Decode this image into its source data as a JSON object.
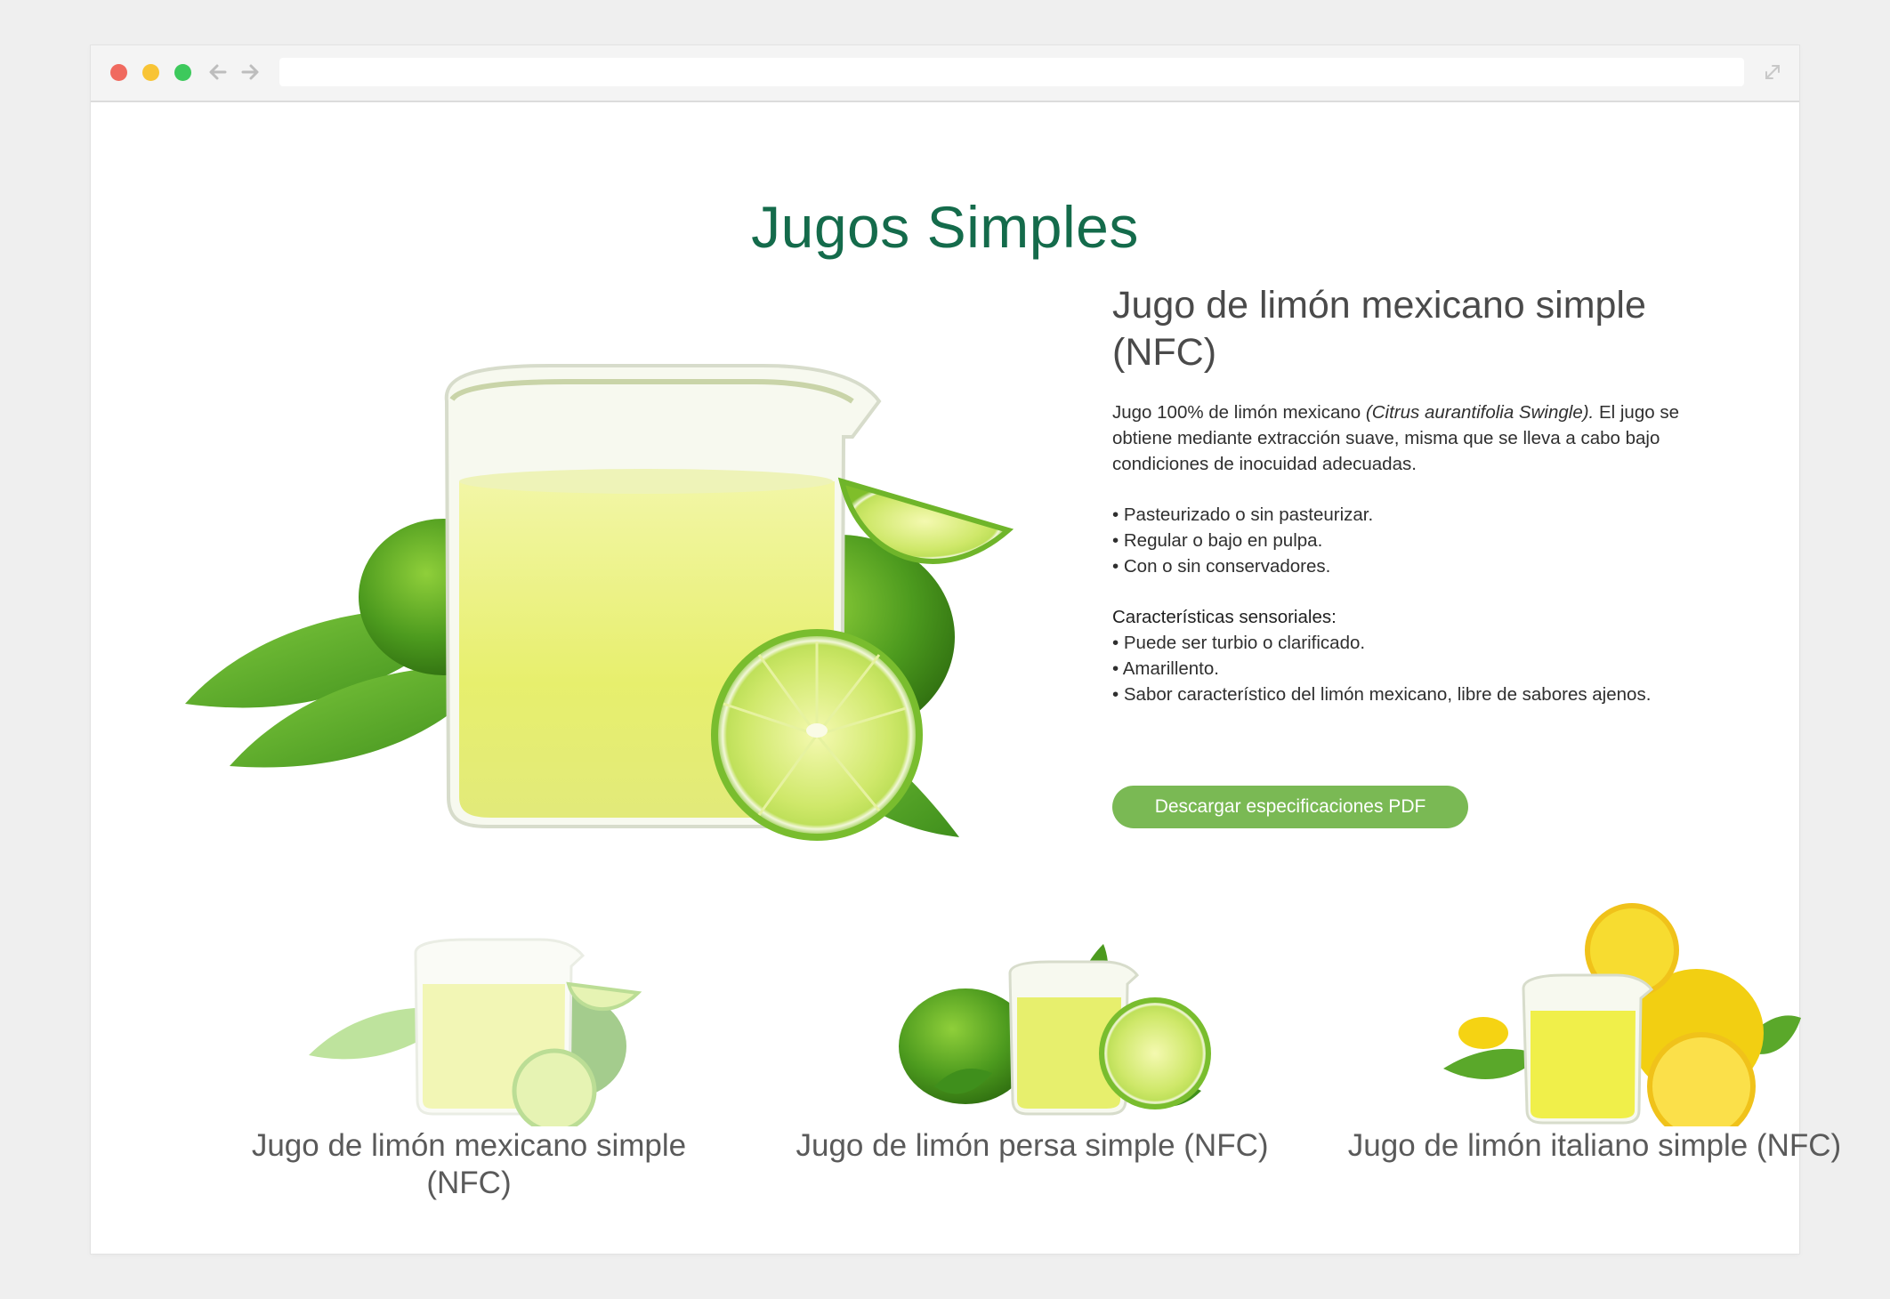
{
  "browser": {
    "url": "",
    "controls": [
      "close",
      "minimize",
      "maximize"
    ],
    "nav_icons": [
      "back-arrow-icon",
      "forward-arrow-icon"
    ],
    "expand_icon": "expand-icon"
  },
  "page": {
    "title": "Jugos Simples",
    "title_color": "#146b4b"
  },
  "product": {
    "name": "Jugo de limón mexicano simple (NFC)",
    "description_prefix": "Jugo 100% de limón mexicano ",
    "scientific_name": "(Citrus aurantifolia Swingle).",
    "description_suffix": " El jugo se obtiene mediante extracción suave, misma que se lleva a cabo bajo condiciones de inocuidad adecuadas.",
    "features": [
      "• Pasteurizado o sin pasteurizar.",
      "• Regular o bajo en pulpa.",
      "• Con o sin conservadores."
    ],
    "sensory_heading": "Características sensoriales:",
    "sensory": [
      "• Puede ser turbio o clarificado.",
      "• Amarillento.",
      "• Sabor característico del limón mexicano, libre de sabores ajenos."
    ],
    "download_label": "Descargar especificaciones PDF",
    "button_color": "#7ab954"
  },
  "cards": [
    {
      "title": "Jugo de limón mexicano simple (NFC)",
      "selected": true
    },
    {
      "title": "Jugo de limón persa simple (NFC)",
      "selected": false
    },
    {
      "title": "Jugo de limón italiano simple (NFC)",
      "selected": false
    }
  ]
}
